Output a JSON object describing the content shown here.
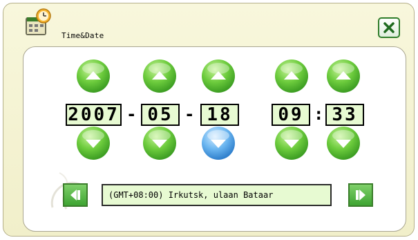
{
  "window": {
    "title": "Time&Date",
    "icon": "calendar-clock-icon",
    "close_icon": "close-x-icon"
  },
  "date": {
    "year": "2007",
    "month": "05",
    "day": "18",
    "separator": "-"
  },
  "time": {
    "hour": "09",
    "minute": "33",
    "separator": ":"
  },
  "timezone": {
    "label": "(GMT+08:00)  Irkutsk, ulaan Bataar",
    "prev_icon": "arrow-left-icon",
    "next_icon": "arrow-right-icon"
  },
  "colors": {
    "button_green": "#5cc43c",
    "button_selected_blue": "#4aa3e8",
    "field_bg": "#e7fad2",
    "window_bg": "#f4f2d1",
    "close_border": "#2f7d2a"
  },
  "selected_spinner": "day-down"
}
